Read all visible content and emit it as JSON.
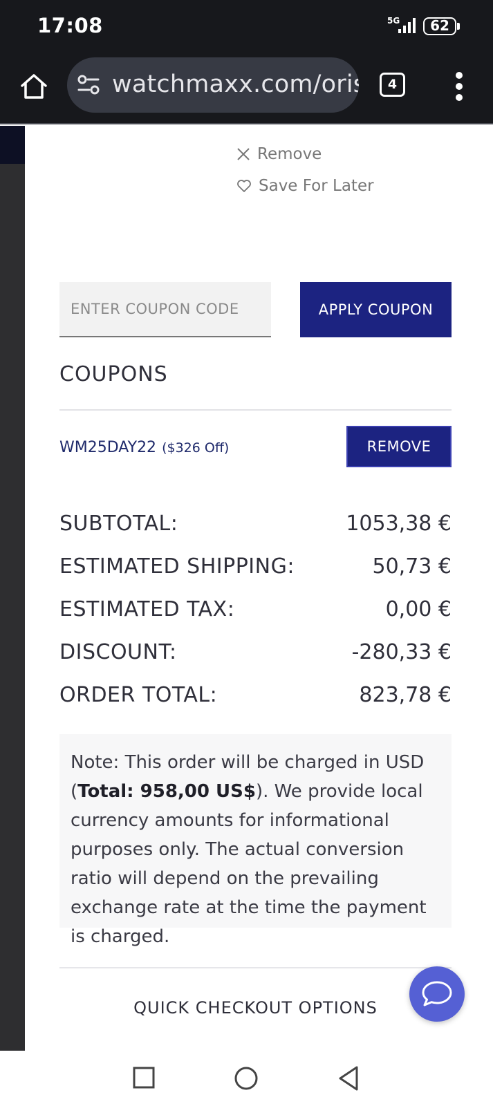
{
  "status_bar": {
    "time": "17:08",
    "network": "5G",
    "battery": "62"
  },
  "browser": {
    "url": "watchmaxx.com/oris-",
    "tab_count": "4"
  },
  "cart_item_actions": {
    "remove_label": "Remove",
    "save_label": "Save For Later"
  },
  "coupon_form": {
    "placeholder": "ENTER COUPON CODE",
    "apply_label": "APPLY COUPON"
  },
  "coupons": {
    "heading": "COUPONS",
    "items": [
      {
        "code": "WM25DAY22",
        "discount": "($326 Off)",
        "remove_label": "REMOVE"
      }
    ]
  },
  "totals": {
    "subtotal_label": "SUBTOTAL:",
    "subtotal_value": "1053,38 €",
    "shipping_label": "ESTIMATED SHIPPING:",
    "shipping_value": "50,73 €",
    "tax_label": "ESTIMATED TAX:",
    "tax_value": "0,00 €",
    "discount_label": "DISCOUNT:",
    "discount_value": "-280,33 €",
    "order_total_label": "ORDER TOTAL:",
    "order_total_value": "823,78 €"
  },
  "note": {
    "prefix": "Note: This order will be charged in USD (",
    "total_bold": "Total: 958,00 US$",
    "suffix": "). We provide local currency amounts for informational purposes only. The actual conversion ratio will depend on the prevailing exchange rate at the time the payment is charged."
  },
  "quick_checkout_label": "QUICK CHECKOUT OPTIONS",
  "colors": {
    "brand_navy": "#1c2381",
    "chat_button": "#5560d4",
    "status_bar_bg": "#17181c"
  }
}
